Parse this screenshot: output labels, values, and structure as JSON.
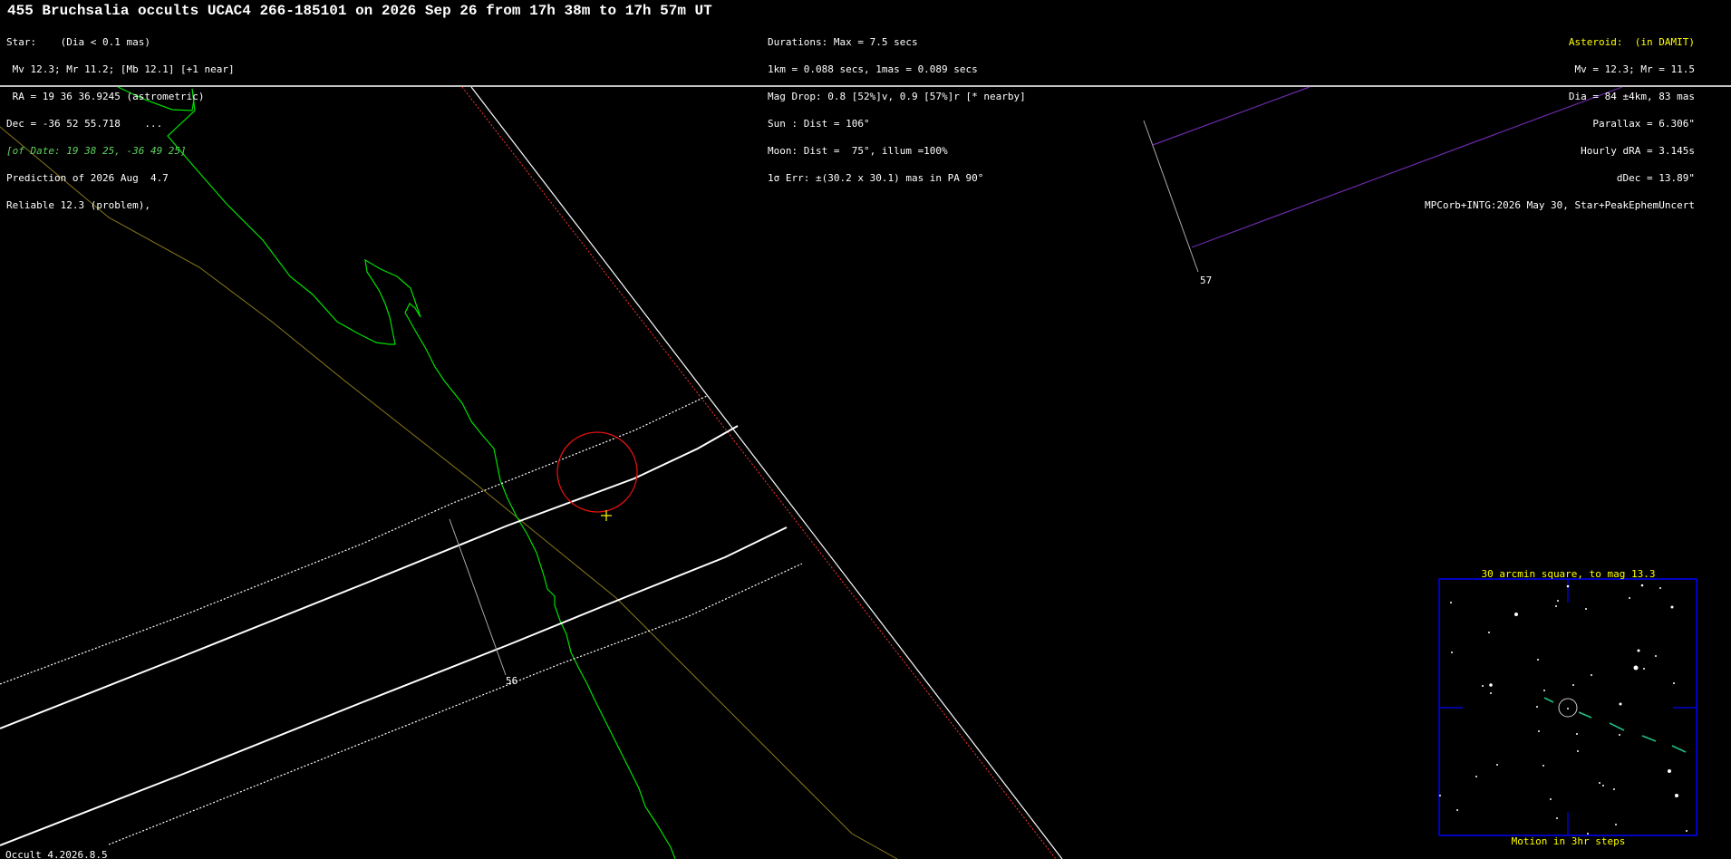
{
  "header": {
    "title": "455 Bruchsalia occults UCAC4 266-185101 on 2026 Sep 26 from 17h 38m to 17h 57m UT"
  },
  "star_info": [
    "Star:    (Dia < 0.1 mas)",
    " Mv 12.3; Mr 11.2; [Mb 12.1] [+1 near]",
    " RA = 19 36 36.9245 (astrometric)",
    "Dec = -36 52 55.718    ...",
    "[of Date: 19 38 25, -36 49 25]",
    "Prediction of 2026 Aug  4.7",
    "Reliable 12.3 (problem),"
  ],
  "event_info": [
    "Durations: Max = 7.5 secs",
    "1km = 0.088 secs, 1mas = 0.089 secs",
    "Mag Drop: 0.8 [52%]v, 0.9 [57%]r [* nearby]",
    "Sun : Dist = 106°",
    "Moon: Dist =  75°, illum =100%",
    "1σ Err: ±(30.2 x 30.1) mas in PA 90°"
  ],
  "asteroid_info": {
    "heading": "Asteroid:  (in DAMIT)",
    "lines": [
      "Mv = 12.3; Mr = 11.5",
      "Dia = 84 ±4km, 83 mas",
      "Parallax = 6.306\"",
      "Hourly dRA = 3.145s",
      "dDec = 13.89\"",
      "MPCorb+INTG:2026 May 30, Star+PeakEphemUncert"
    ]
  },
  "map_labels": {
    "time_56": "56",
    "time_57": "57"
  },
  "inset": {
    "title": "30 arcmin square, to mag 13.3",
    "footer": "Motion in 3hr steps"
  },
  "footer": {
    "version": "Occult 4.2026.8.5"
  },
  "colors": {
    "background": "#000000",
    "path_line": "#ffffff",
    "coastline": "#00e000",
    "border": "#8a7a1a",
    "terminator": "#ff3030",
    "site_circle": "#e01010",
    "site_marker": "#ffff00",
    "offmap_path": "#6a2aa8",
    "inset_frame": "#0000ff",
    "motion": "#20c080"
  },
  "icons": {
    "site_marker": "plus-marker-icon",
    "site_circle": "circle-icon"
  }
}
